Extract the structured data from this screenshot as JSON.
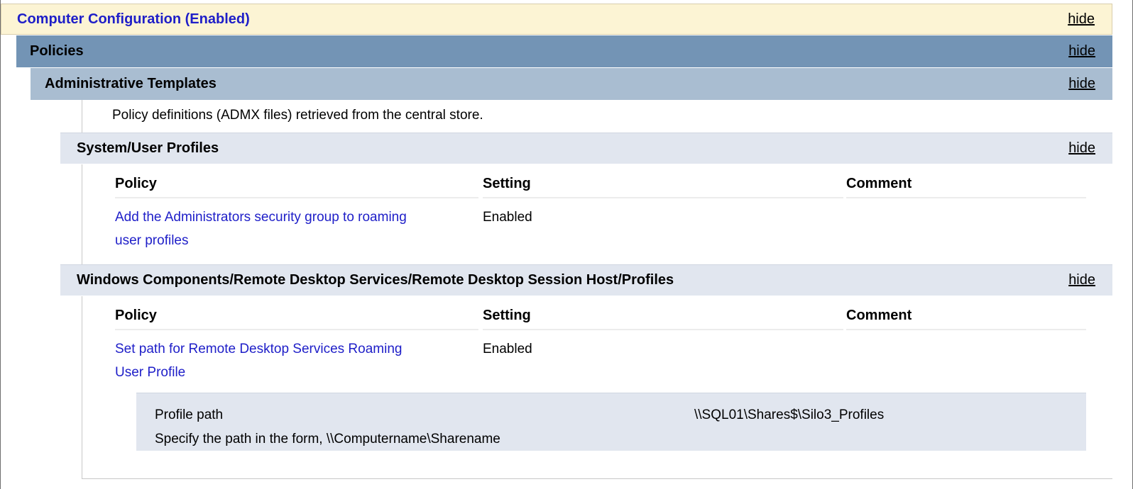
{
  "computer_config": {
    "title": "Computer Configuration (Enabled)",
    "hide_label": "hide"
  },
  "policies": {
    "title": "Policies",
    "hide_label": "hide"
  },
  "admin_templates": {
    "title": "Administrative Templates",
    "hide_label": "hide",
    "description": "Policy definitions (ADMX files) retrieved from the central store."
  },
  "sections": [
    {
      "title": "System/User Profiles",
      "hide_label": "hide",
      "columns": [
        "Policy",
        "Setting",
        "Comment"
      ],
      "rows": [
        {
          "policy_line1": "Add the Administrators security group to roaming",
          "policy_line2": "user profiles",
          "setting": "Enabled",
          "comment": ""
        }
      ]
    },
    {
      "title": "Windows Components/Remote Desktop Services/Remote Desktop Session Host/Profiles",
      "hide_label": "hide",
      "columns": [
        "Policy",
        "Setting",
        "Comment"
      ],
      "rows": [
        {
          "policy_line1": "Set path for Remote Desktop Services Roaming",
          "policy_line2": "User Profile",
          "setting": "Enabled",
          "comment": "",
          "details": {
            "label": "Profile path",
            "value": "\\\\SQL01\\Shares$\\Silo3_Profiles",
            "hint": "Specify the path in the form, \\\\Computername\\Sharename"
          }
        }
      ]
    }
  ],
  "colors": {
    "link": "#1e1ec8",
    "cc_header_bg": "#fcf4d4",
    "policies_bg": "#7394b5",
    "admin_bg": "#a9bdd1",
    "section_bg": "#e1e6ef"
  }
}
